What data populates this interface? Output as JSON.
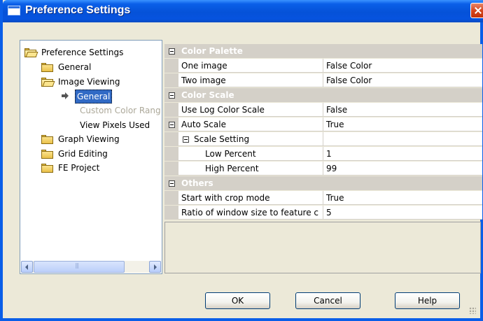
{
  "window": {
    "title": "Preference Settings"
  },
  "tree": {
    "root": "Preference Settings",
    "items": [
      {
        "label": "General"
      },
      {
        "label": "Image Viewing"
      },
      {
        "label": "General"
      },
      {
        "label": "Custom Color Rang"
      },
      {
        "label": "View Pixels Used"
      },
      {
        "label": "Graph Viewing"
      },
      {
        "label": "Grid Editing"
      },
      {
        "label": "FE Project"
      }
    ]
  },
  "grid": {
    "categories": {
      "color_palette": "Color Palette",
      "color_scale": "Color Scale",
      "others": "Others"
    },
    "rows": {
      "one_image": {
        "name": "One image",
        "value": "False Color"
      },
      "two_image": {
        "name": "Two image",
        "value": "False Color"
      },
      "use_log": {
        "name": "Use Log Color Scale",
        "value": "False"
      },
      "auto_scale": {
        "name": "Auto Scale",
        "value": "True"
      },
      "scale_setting": {
        "name": "Scale Setting",
        "value": ""
      },
      "low_percent": {
        "name": "Low Percent",
        "value": "1"
      },
      "high_percent": {
        "name": "High Percent",
        "value": "99"
      },
      "crop_mode": {
        "name": "Start with crop mode",
        "value": "True"
      },
      "ratio": {
        "name": "Ratio of window size to feature c",
        "value": "5"
      }
    }
  },
  "buttons": {
    "ok": "OK",
    "cancel": "Cancel",
    "help": "Help"
  }
}
